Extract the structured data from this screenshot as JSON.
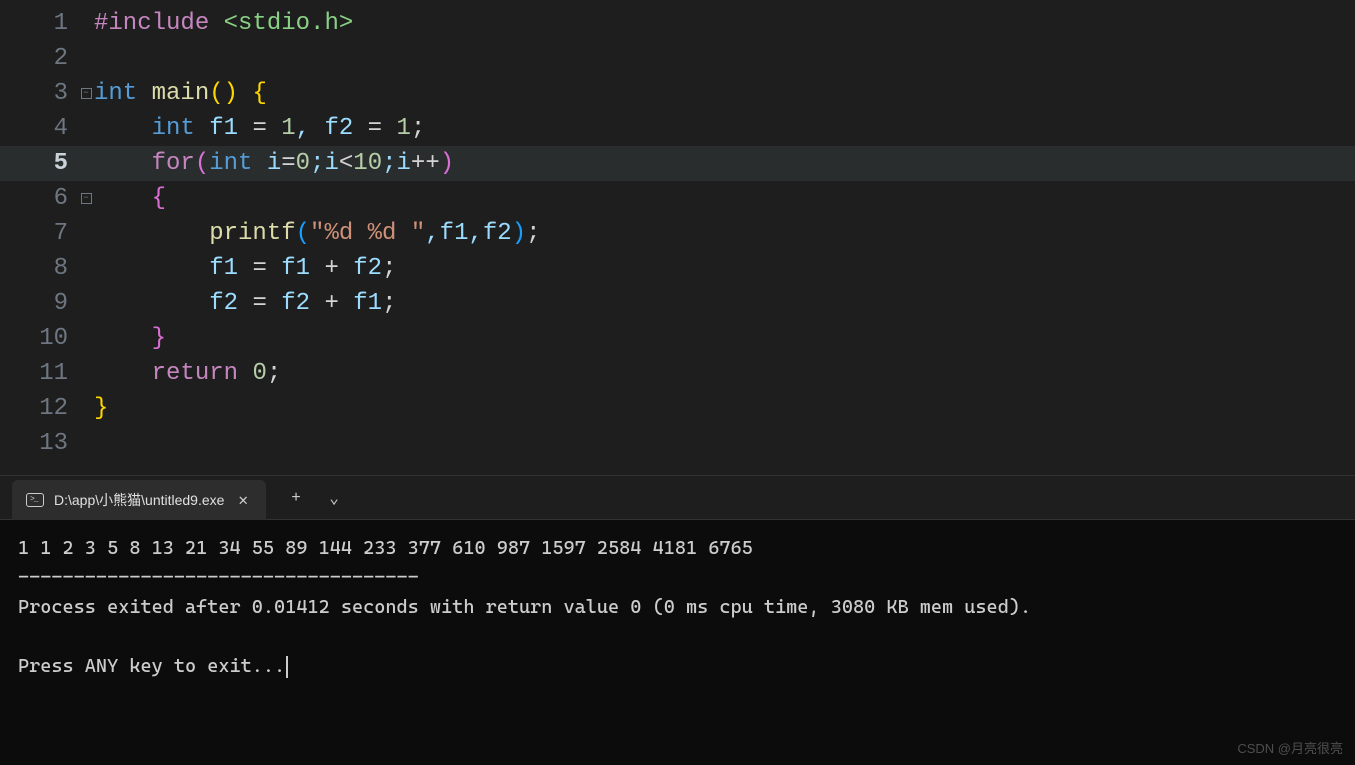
{
  "code": {
    "lines": [
      {
        "n": "1",
        "fold": "",
        "guide": ""
      },
      {
        "n": "2",
        "fold": "",
        "guide": ""
      },
      {
        "n": "3",
        "fold": "box",
        "guide": ""
      },
      {
        "n": "4",
        "fold": "line",
        "guide": ""
      },
      {
        "n": "5",
        "fold": "line",
        "guide": "",
        "hl": true
      },
      {
        "n": "6",
        "fold": "box",
        "guide": ""
      },
      {
        "n": "7",
        "fold": "line",
        "guide": ""
      },
      {
        "n": "8",
        "fold": "line",
        "guide": ""
      },
      {
        "n": "9",
        "fold": "line",
        "guide": ""
      },
      {
        "n": "10",
        "fold": "line",
        "guide": ""
      },
      {
        "n": "11",
        "fold": "line",
        "guide": ""
      },
      {
        "n": "12",
        "fold": "end",
        "guide": ""
      },
      {
        "n": "13",
        "fold": "",
        "guide": ""
      }
    ],
    "l1_hash": "#include",
    "l1_inc": " <stdio.h>",
    "l3_int": "int",
    "l3_main": " main",
    "l3_p1": "(",
    "l3_p2": ")",
    "l3_sp": " ",
    "l3_br": "{",
    "l4_pad": "    ",
    "l4_int": "int",
    "l4_rest": " f1 ",
    "l4_eq": "=",
    "l4_sp": " ",
    "l4_n1": "1",
    "l4_c": ", f2 ",
    "l4_n2": "1",
    "l4_sc": ";",
    "l5_pad": "    ",
    "l5_for": "for",
    "l5_p1": "(",
    "l5_int": "int",
    "l5_i": " i",
    "l5_eq": "=",
    "l5_z": "0",
    "l5_sc1": ";i",
    "l5_lt": "<",
    "l5_ten": "10",
    "l5_sc2": ";i",
    "l5_pp": "++",
    "l5_p2": ")",
    "l6_pad": "    ",
    "l6_br": "{",
    "l7_pad": "        ",
    "l7_printf": "printf",
    "l7_p1": "(",
    "l7_str": "\"%d %d \"",
    "l7_args": ",f1,f2",
    "l7_p2": ")",
    "l7_sc": ";",
    "l8_pad": "        f1 ",
    "l8_eq": "=",
    "l8_rest": " f1 ",
    "l8_plus": "+",
    "l8_f2": " f2",
    "l8_sc": ";",
    "l9_pad": "        f2 ",
    "l9_eq": "=",
    "l9_rest": " f2 ",
    "l9_plus": "+",
    "l9_f1": " f1",
    "l9_sc": ";",
    "l10_pad": "    ",
    "l10_br": "}",
    "l11_pad": "    ",
    "l11_ret": "return",
    "l11_sp": " ",
    "l11_z": "0",
    "l11_sc": ";",
    "l12_br": "}"
  },
  "terminal": {
    "tab_title": "D:\\app\\小熊猫\\untitled9.exe",
    "output_line1": "1 1 2 3 5 8 13 21 34 55 89 144 233 377 610 987 1597 2584 4181 6765",
    "output_sep": "------------------------------------",
    "output_line2": "Process exited after 0.01412 seconds with return value 0 (0 ms cpu time, 3080 KB mem used).",
    "output_blank": "",
    "output_line3": "Press ANY key to exit...",
    "plus": "+",
    "chevron": "⌄",
    "close": "✕"
  },
  "watermark": "CSDN @月亮很亮"
}
